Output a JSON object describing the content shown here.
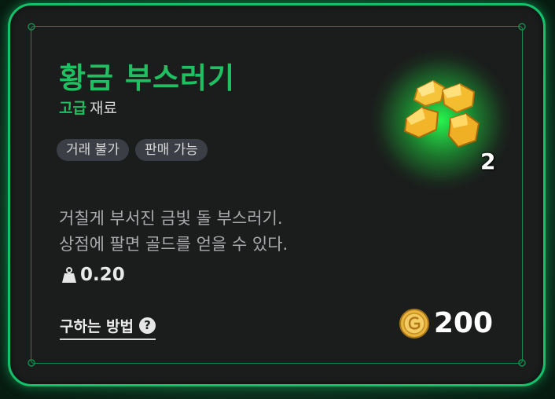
{
  "item": {
    "name": "황금 부스러기",
    "grade": "고급",
    "category": "재료",
    "tags": [
      "거래 불가",
      "판매 가능"
    ],
    "description": [
      "거칠게 부서진 금빛 돌 부스러기.",
      "상점에 팔면 골드를 얻을 수 있다."
    ],
    "weight": "0.20",
    "quantity": "2",
    "how_to_obtain_label": "구하는 방법",
    "sell_price": "200"
  },
  "icons": {
    "weight": "weight-icon",
    "help": "question-circle-icon",
    "currency": "gold-coin-icon",
    "item": "gold-nuggets"
  },
  "colors": {
    "accent_green": "#1fbf62",
    "frame_green": "#12c26a",
    "panel_bg": "#1b1c1c",
    "tag_bg": "#3b3e45",
    "coin_gold": "#e8b43c"
  }
}
